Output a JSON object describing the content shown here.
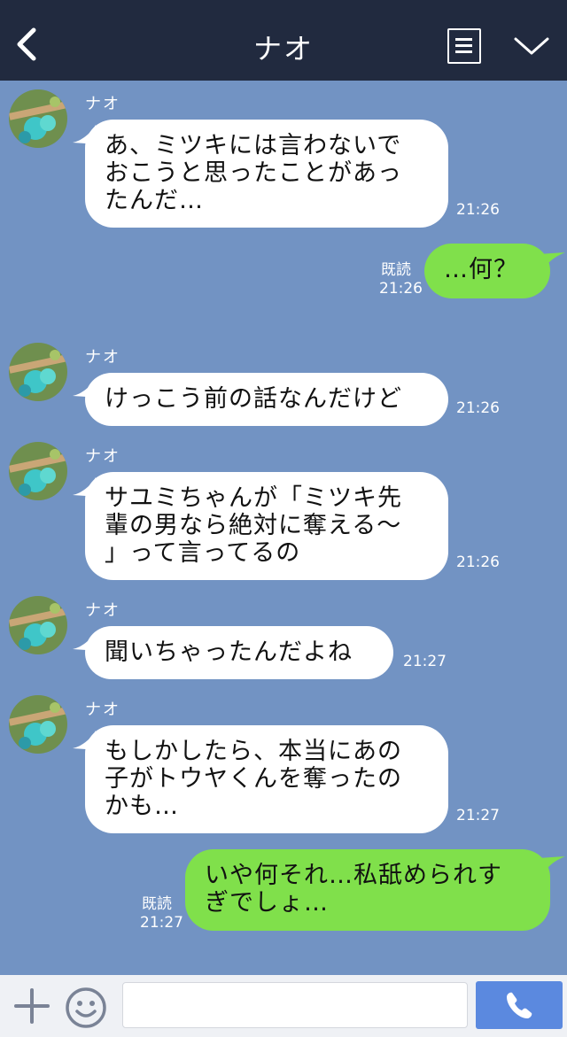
{
  "header": {
    "title": "ナオ",
    "icons": {
      "back": "back-chevron-icon",
      "menu": "menu-list-icon",
      "collapse": "chevron-down-icon"
    }
  },
  "messages": [
    {
      "sender": "ナオ",
      "direction": "incoming",
      "text": "あ、ミツキには言わないで\nおこうと思ったことがあっ\nたんだ…",
      "time": "21:26"
    },
    {
      "direction": "outgoing",
      "text": "…何？",
      "read": "既読",
      "time": "21:26"
    },
    {
      "sender": "ナオ",
      "direction": "incoming",
      "text": "けっこう前の話なんだけど",
      "time": "21:26"
    },
    {
      "sender": "ナオ",
      "direction": "incoming",
      "text": "サユミちゃんが「ミツキ先\n輩の男なら絶対に奪える〜\n」って言ってるの",
      "time": "21:26"
    },
    {
      "sender": "ナオ",
      "direction": "incoming",
      "text": "聞いちゃったんだよね",
      "time": "21:27"
    },
    {
      "sender": "ナオ",
      "direction": "incoming",
      "text": "もしかしたら、本当にあの\n子がトウヤくんを奪ったの\nかも…",
      "time": "21:27"
    },
    {
      "direction": "outgoing",
      "text": "いや何それ…私舐められす\nぎでしょ…",
      "read": "既読",
      "time": "21:27"
    }
  ],
  "footer": {
    "input_value": "",
    "icons": {
      "plus": "plus-icon",
      "emoji": "smiley-icon",
      "call": "phone-icon"
    }
  },
  "colors": {
    "header_bg": "#212a3f",
    "chat_bg": "#7293c3",
    "incoming_bubble": "#ffffff",
    "outgoing_bubble": "#80e04b",
    "call_button": "#5b89df"
  }
}
